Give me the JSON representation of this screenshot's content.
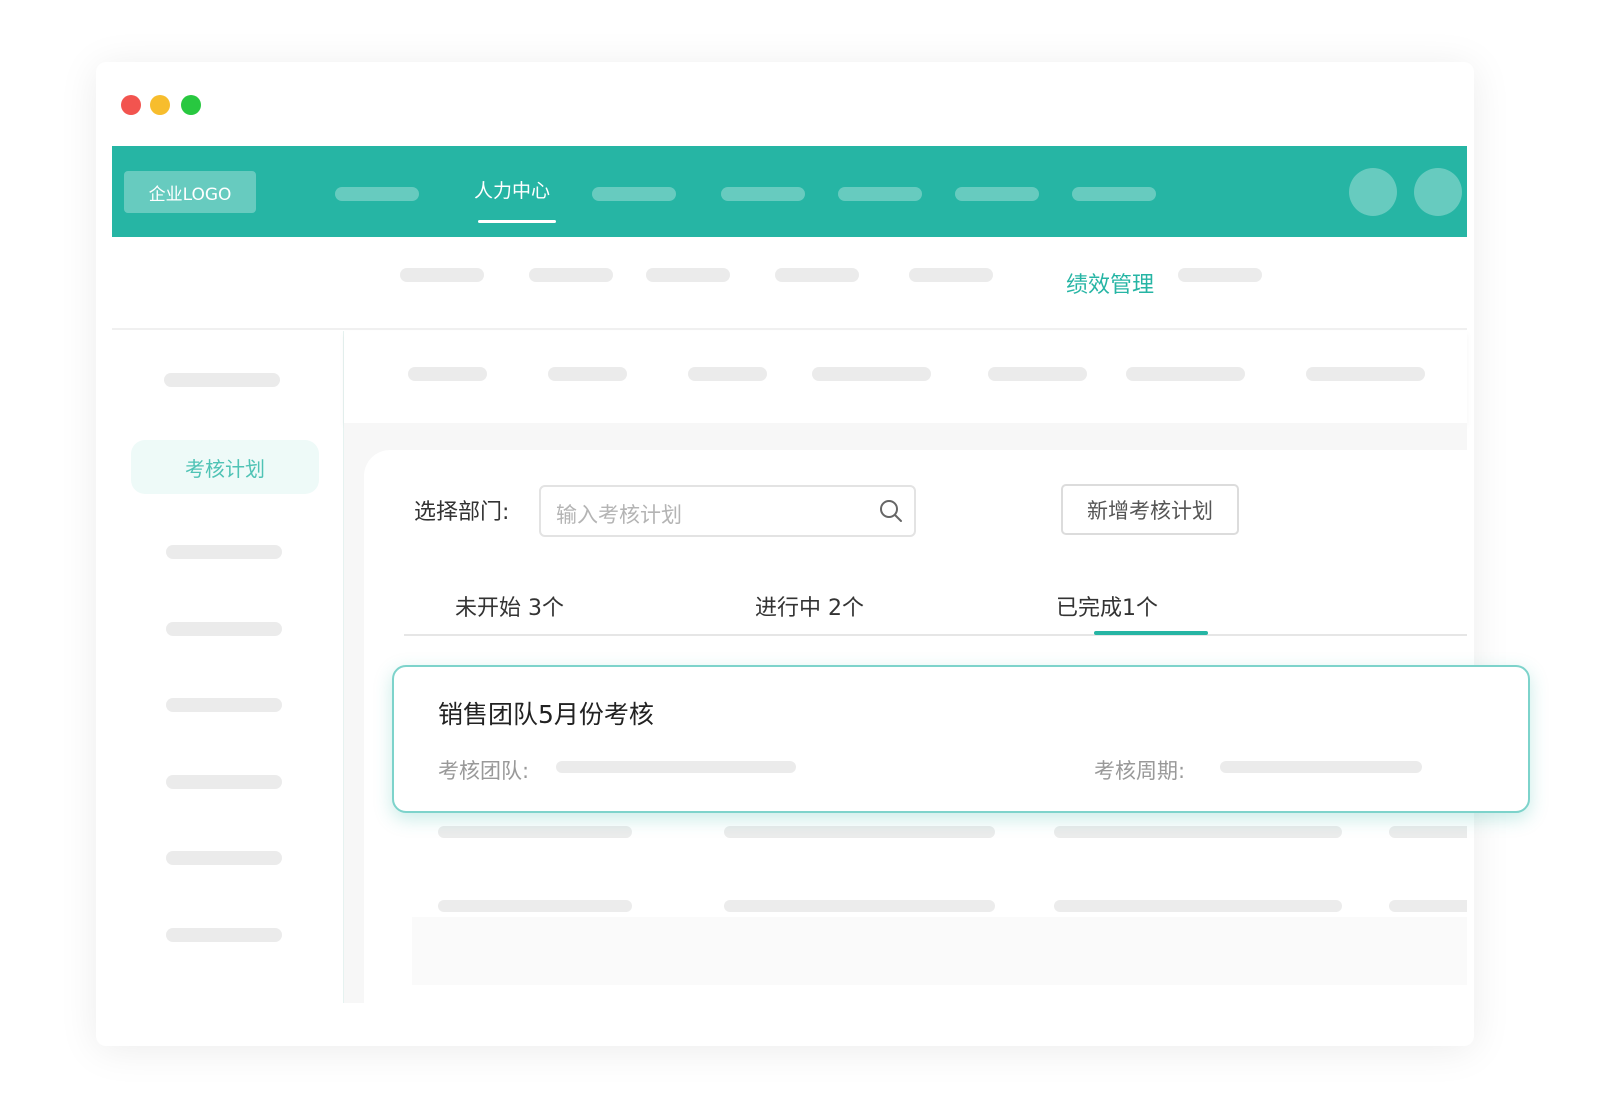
{
  "header": {
    "logo_text": "企业LOGO",
    "active_nav": "人力中心"
  },
  "subnav": {
    "active_item": "绩效管理"
  },
  "sidebar": {
    "active_item": "考核计划"
  },
  "toolbar": {
    "dept_label": "选择部门:",
    "search_placeholder": "输入考核计划",
    "add_button": "新增考核计划"
  },
  "tabs": [
    {
      "label": "未开始 3个"
    },
    {
      "label": "进行中 2个"
    },
    {
      "label": "已完成1个"
    }
  ],
  "active_tab": 2,
  "card": {
    "title": "销售团队5月份考核",
    "team_label": "考核团队:",
    "period_label": "考核周期:"
  },
  "colors": {
    "brand": "#26b5a4",
    "brand_light": "#eefaf8",
    "card_border": "#7dd3cb",
    "traffic_red": "#f2544f",
    "traffic_yellow": "#f7bd2d",
    "traffic_green": "#28c840"
  }
}
